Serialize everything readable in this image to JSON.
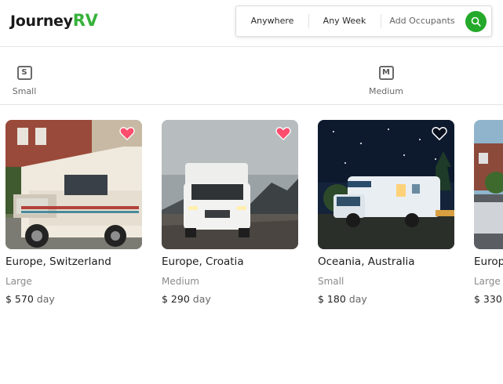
{
  "brand": {
    "name_part1": "Journey",
    "name_part2": "RV",
    "accent_color": "#36b23a"
  },
  "search": {
    "where": "Anywhere",
    "when": "Any Week",
    "occupants": "Add Occupants",
    "button_icon": "search-icon",
    "button_color": "#25a92b"
  },
  "size_filters": [
    {
      "badge": "S",
      "label": "Small"
    },
    {
      "badge": "M",
      "label": "Medium"
    }
  ],
  "listings": [
    {
      "title": "Europe, Switzerland",
      "size": "Large",
      "price": "$ 570",
      "unit": "day",
      "favorited": true,
      "image": "white-vintage-rv-near-brick-building"
    },
    {
      "title": "Europe, Croatia",
      "size": "Medium",
      "price": "$ 290",
      "unit": "day",
      "favorited": true,
      "image": "white-motorhome-on-rocky-road-under-cloudy-sky"
    },
    {
      "title": "Oceania, Australia",
      "size": "Small",
      "price": "$ 180",
      "unit": "day",
      "favorited": false,
      "image": "motorhome-under-starry-night-sky"
    },
    {
      "title": "Europ",
      "size": "Large",
      "price": "$ 330",
      "unit": "",
      "favorited": false,
      "image": "rv-near-houses-partial"
    }
  ],
  "colors": {
    "heart_active": "#ff4d6d",
    "heart_inactive": "#ffffff"
  }
}
